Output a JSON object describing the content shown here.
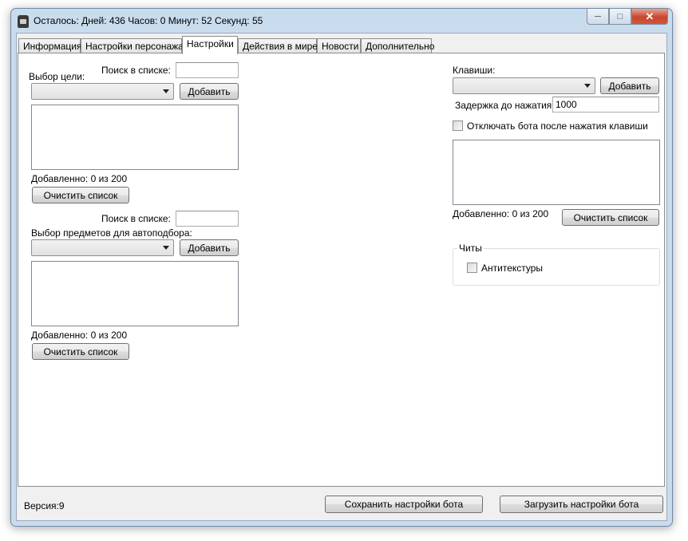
{
  "window": {
    "title": "Осталось: Дней: 436 Часов: 0 Минут: 52 Секунд: 55",
    "app_icon": "robot-icon",
    "minimize_icon": "minimize-icon",
    "maximize_icon": "maximize-icon",
    "close_icon": "close-icon",
    "minimize_glyph": "─",
    "maximize_glyph": "□",
    "close_glyph": "✕"
  },
  "tabs": [
    {
      "label": "Информация",
      "active": false
    },
    {
      "label": "Настройки персонажа",
      "active": false
    },
    {
      "label": "Настройки",
      "active": true
    },
    {
      "label": "Действия в мире",
      "active": false
    },
    {
      "label": "Новости",
      "active": false
    },
    {
      "label": "Дополнительно",
      "active": false
    }
  ],
  "targets": {
    "search_label": "Поиск в списке:",
    "search_value": "",
    "select_label": "Выбор цели:",
    "combo_value": "",
    "add_button": "Добавить",
    "added_text": "Добавленно: 0 из 200",
    "clear_button": "Очистить список"
  },
  "items": {
    "search_label": "Поиск в списке:",
    "search_value": "",
    "select_label": "Выбор предметов для автоподбора:",
    "combo_value": "",
    "add_button": "Добавить",
    "added_text": "Добавленно: 0 из 200",
    "clear_button": "Очистить список"
  },
  "keys": {
    "label": "Клавиши:",
    "combo_value": "",
    "add_button": "Добавить",
    "delay_label": "Задержка до нажатия:",
    "delay_value": "1000",
    "disable_checkbox_label": "Отключать бота после нажатия клавиши",
    "disable_checked": false,
    "added_text": "Добавленно: 0 из 200",
    "clear_button": "Очистить список"
  },
  "cheats": {
    "group_title": "Читы",
    "antitextures_label": "Антитекстуры",
    "antitextures_checked": false
  },
  "footer": {
    "version": "Версия:9",
    "save_button": "Сохранить настройки бота",
    "load_button": "Загрузить настройки бота"
  }
}
